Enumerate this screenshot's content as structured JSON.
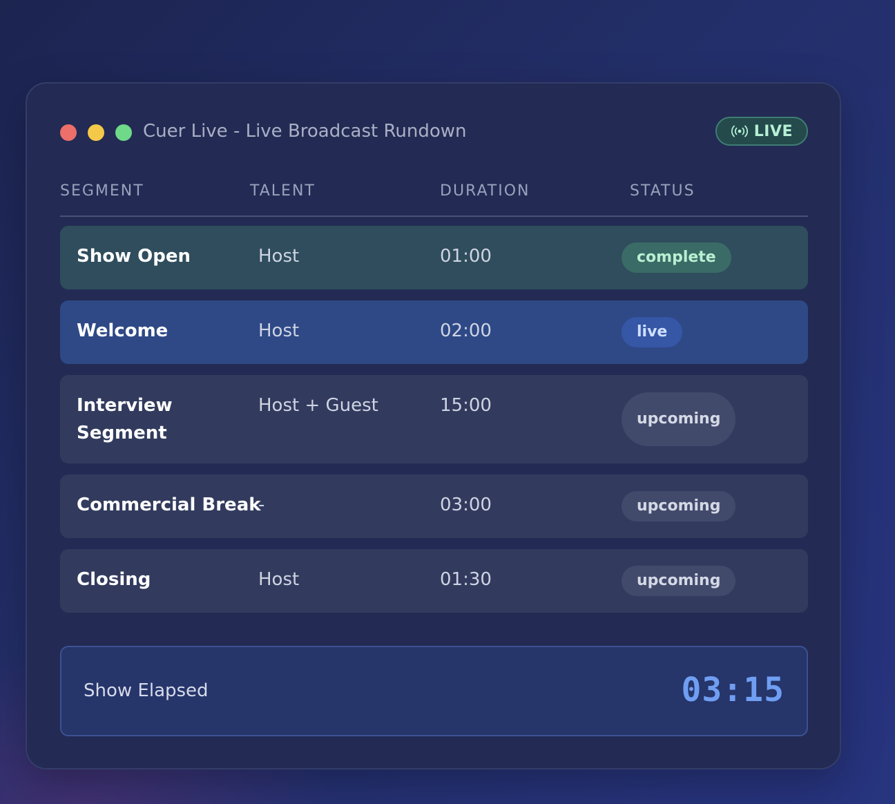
{
  "window": {
    "title": "Cuer Live - Live Broadcast Rundown",
    "live_badge": "LIVE"
  },
  "columns": {
    "segment": "SEGMENT",
    "talent": "TALENT",
    "duration": "DURATION",
    "status": "STATUS"
  },
  "rows": [
    {
      "segment": "Show Open",
      "talent": "Host",
      "duration": "01:00",
      "status": "complete"
    },
    {
      "segment": "Welcome",
      "talent": "Host",
      "duration": "02:00",
      "status": "live"
    },
    {
      "segment": "Interview Segment",
      "talent": "Host + Guest",
      "duration": "15:00",
      "status": "upcoming"
    },
    {
      "segment": "Commercial Break",
      "talent": "-",
      "duration": "03:00",
      "status": "upcoming"
    },
    {
      "segment": "Closing",
      "talent": "Host",
      "duration": "01:30",
      "status": "upcoming"
    }
  ],
  "elapsed": {
    "label": "Show Elapsed",
    "value": "03:15"
  },
  "colors": {
    "complete": "#3b6b66",
    "live": "#3656a6",
    "upcoming": "#424a6c",
    "accent": "#6f9ef2"
  },
  "icons": {
    "live": "broadcast-icon"
  }
}
